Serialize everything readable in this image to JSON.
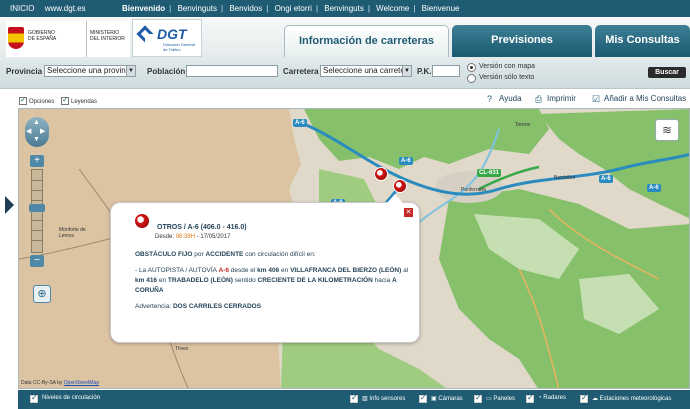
{
  "topbar": {
    "inicio": "INICIO",
    "site": "www.dgt.es",
    "languages": [
      "Bienvenido",
      "Benvinguts",
      "Benvidos",
      "Ongi etorri",
      "Benvinguts",
      "Welcome",
      "Bienvenue"
    ]
  },
  "header": {
    "gov_line1": "GOBIERNO",
    "gov_line2": "DE ESPAÑA",
    "ministry_line1": "MINISTERIO",
    "ministry_line2": "DEL INTERIOR",
    "dgt_title": "DGT",
    "dgt_sub1": "Dirección General",
    "dgt_sub2": "de Tráfico",
    "tabs": [
      {
        "label": "Información de carreteras",
        "active": true
      },
      {
        "label": "Previsiones",
        "active": false
      },
      {
        "label": "Mis Consultas",
        "active": false
      }
    ]
  },
  "search": {
    "provincia_label": "Provincia",
    "provincia_value": "Seleccione una provincia",
    "poblacion_label": "Población",
    "carretera_label": "Carretera",
    "carretera_value": "Seleccione una carretera",
    "pk_label": "P.K.",
    "version_map": "Versión con mapa",
    "version_text": "Versión sólo texto",
    "buscar": "Buscar"
  },
  "tools": {
    "opciones": "Opciones",
    "leyendas": "Leyendas",
    "ayuda": "Ayuda",
    "imprimir": "Imprimir",
    "add_consultas": "Añadir a Mis Consultas"
  },
  "map": {
    "roads": [
      "A-6",
      "A-6",
      "A-6",
      "CL-631",
      "A-6",
      "A-6"
    ],
    "towns": [
      "Toreno",
      "Bembibre",
      "Ponferrada",
      "Monforte de Lemos",
      "Trives"
    ],
    "attribution": "Data CC-By-SA by",
    "attribution_link": "OpenStreetMap"
  },
  "popup": {
    "title": "OTROS / A-6 (406.0 - 416.0)",
    "date_prefix": "Desde:",
    "time": "06:38H",
    "date": "- 17/05/2017",
    "heading_1": "OBSTÁCULO FIJO",
    "heading_2": "por",
    "heading_3": "ACCIDENTE",
    "heading_4": "con circulación difícil en:",
    "desc_a": "- La AUTOPISTA / AUTOVÍA",
    "desc_road": "A-6",
    "desc_b": "desde el",
    "desc_km1": "km 406",
    "desc_c": "en",
    "desc_place1": "VILLAFRANCA DEL BIERZO (LEÓN)",
    "desc_d": "al",
    "desc_km2": "km 416",
    "desc_e": "en",
    "desc_place2": "TRABADELO (LEÓN)",
    "desc_f": "sentido",
    "desc_dir": "CRECIENTE DE LA KILOMETRACIÓN",
    "desc_g": "hacia",
    "desc_dest": "A CORUÑA",
    "warning_label": "Advertencia:",
    "warning_text": "DOS CARRILES CERRADOS"
  },
  "bottombar": {
    "niveles": "Niveles de circulación",
    "items": [
      "Info sensores",
      "Cámaras",
      "Paneles",
      "Radares",
      "Estaciones meteorológicas"
    ]
  },
  "colors": {
    "brand_dark": "#1f5c73",
    "forest": "#7cb963",
    "land": "#e0d8c8",
    "river": "#7ec3e0",
    "road": "#2a8bbf"
  }
}
